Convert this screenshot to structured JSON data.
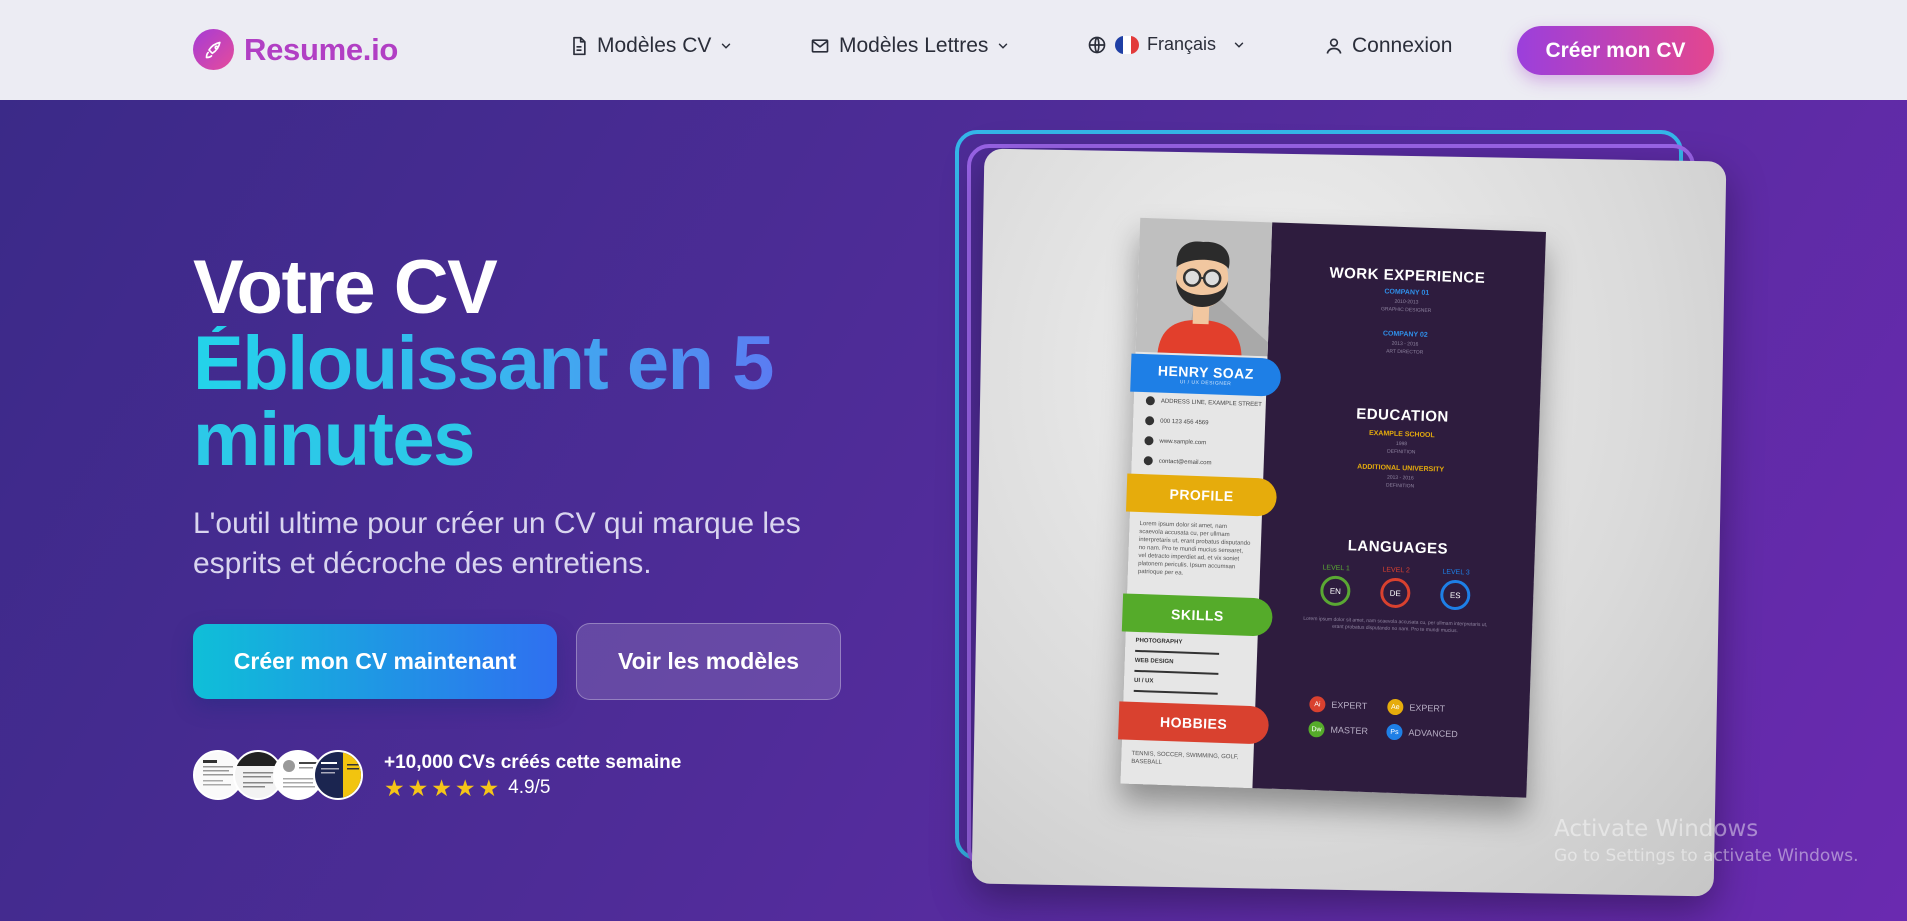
{
  "header": {
    "brand": "Resume.io",
    "nav": {
      "templates": "Modèles CV",
      "letters": "Modèles Lettres",
      "language": "Français",
      "login": "Connexion"
    },
    "cta": "Créer mon CV"
  },
  "hero": {
    "title_line1": "Votre CV",
    "title_line2": "Éblouissant en 5",
    "title_line3": "minutes",
    "subtitle": "L'outil ultime pour créer un CV qui marque les esprits et décroche des entretiens.",
    "primary_button": "Créer mon CV maintenant",
    "secondary_button": "Voir les modèles",
    "social_proof": "+10,000 CVs créés cette semaine",
    "rating": "4.9/5",
    "stars": 5
  },
  "resume_preview": {
    "name": "HENRY SOAZ",
    "role": "UI / UX DESIGNER",
    "contact": [
      "ADDRESS LINE, EXAMPLE STREET",
      "000 123 456 4569",
      "www.sample.com",
      "contact@email.com"
    ],
    "profile_label": "PROFILE",
    "profile_text": "Lorem ipsum dolor sit amet, nam scaevola accusata cu, per ullmam interpretaris ut, erant probatus disputando no nam. Pro te mundi mucius sensaret, vel detracto imperdiet ad, et vix soniet platonem periculis. Ipsum accumsan patrioque per ea.",
    "skills_label": "SKILLS",
    "skills": [
      "PHOTOGRAPHY",
      "WEB DESIGN",
      "UI / UX"
    ],
    "hobbies_label": "HOBBIES",
    "hobbies_text": "TENNIS, SOCCER, SWIMMING, GOLF, BASEBALL",
    "work_title": "WORK EXPERIENCE",
    "work": [
      {
        "company": "COMPANY 01",
        "years": "2010-2013",
        "role": "GRAPHIC DESIGNER"
      },
      {
        "company": "COMPANY 02",
        "years": "2013 - 2016",
        "role": "ART DIRECTOR"
      }
    ],
    "education_title": "EDUCATION",
    "education": [
      {
        "school": "EXAMPLE SCHOOL",
        "years": "1998",
        "detail": "DEFINITION"
      },
      {
        "school": "ADDITIONAL UNIVERSITY",
        "years": "2013 - 2016",
        "detail": "DEFINITION"
      }
    ],
    "languages_title": "LANGUAGES",
    "languages": [
      {
        "level": "LEVEL 1",
        "code": "EN",
        "color": "#5aa833"
      },
      {
        "level": "LEVEL 2",
        "code": "DE",
        "color": "#d9412f"
      },
      {
        "level": "LEVEL 3",
        "code": "ES",
        "color": "#1e7fe6"
      }
    ],
    "languages_text": "Lorem ipsum dolor sit amet, nam scaevola accusata cu, per ullmam interpretaris ut, erant probatus disputando no nam. Pro te mundi mucius.",
    "tools": [
      {
        "icon": "Ai",
        "label": "EXPERT",
        "color": "#d9412f"
      },
      {
        "icon": "Ae",
        "label": "EXPERT",
        "color": "#e6ac0c"
      },
      {
        "icon": "Dw",
        "label": "MASTER",
        "color": "#55ab2a"
      },
      {
        "icon": "Ps",
        "label": "ADVANCED",
        "color": "#1e7fe6"
      }
    ]
  },
  "watermark": {
    "title": "Activate Windows",
    "subtitle": "Go to Settings to activate Windows."
  },
  "colors": {
    "brand": "#b13fc4",
    "accent_gradient_start": "#9b3fdc",
    "accent_gradient_end": "#e3468f",
    "hero_bg": "#4f2c98",
    "title_cyan": "#2cc9e8",
    "star": "#f5c518"
  }
}
